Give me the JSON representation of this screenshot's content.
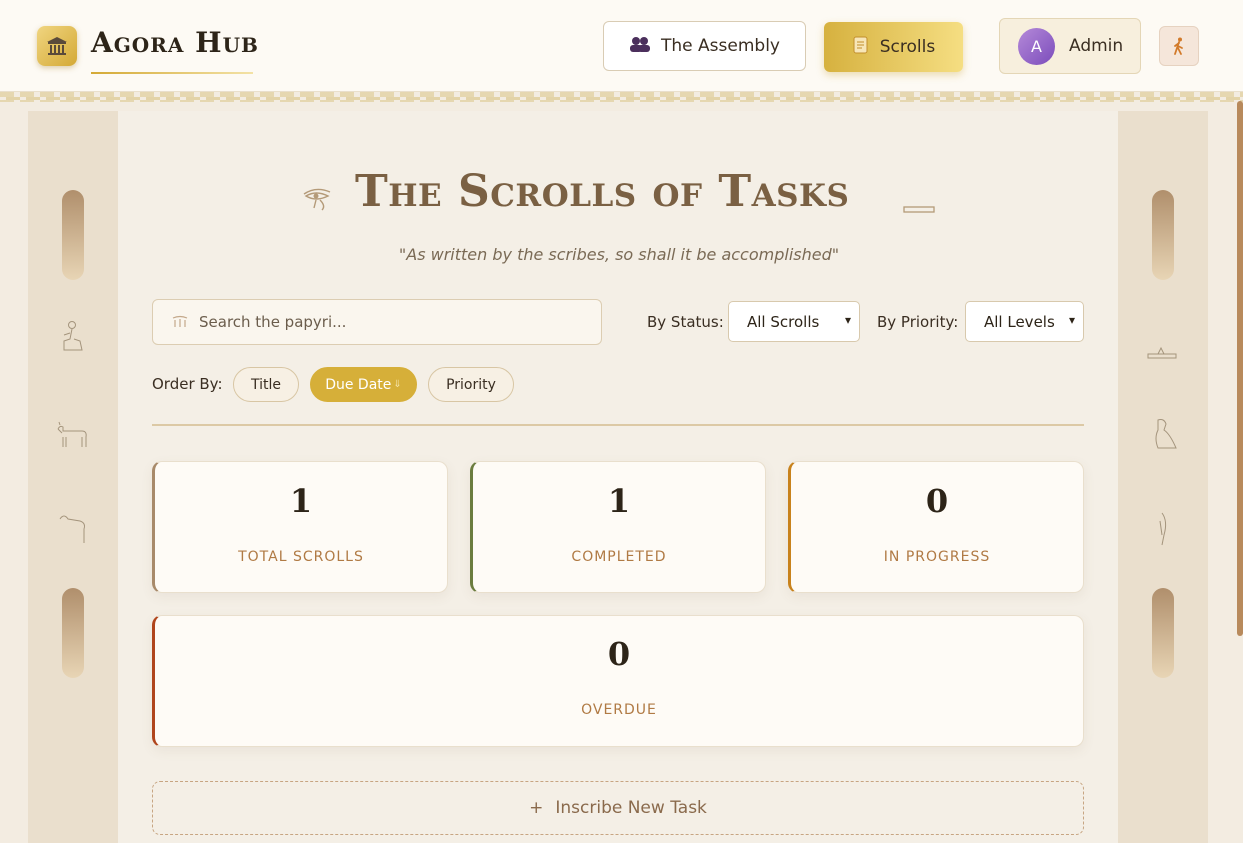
{
  "header": {
    "brand": "Agora Hub",
    "logo_icon": "temple-icon",
    "nav": {
      "assembly_label": "The Assembly",
      "scrolls_label": "Scrolls"
    },
    "user": {
      "avatar_initial": "A",
      "name": "Admin"
    },
    "logout_icon": "walking-figure-icon"
  },
  "page": {
    "title": "The Scrolls of Tasks",
    "subtitle": "\"As written by the scribes, so shall it be accomplished\""
  },
  "filters": {
    "search_placeholder": "Search the papyri...",
    "status_label": "By Status:",
    "status_value": "All Scrolls",
    "priority_label": "By Priority:",
    "priority_value": "All Levels",
    "order_label": "Order By:",
    "order_options": [
      "Title",
      "Due Date",
      "Priority"
    ],
    "order_active": "Due Date"
  },
  "stats": [
    {
      "value": "1",
      "label": "TOTAL SCROLLS",
      "accent": "#a88a6a"
    },
    {
      "value": "1",
      "label": "COMPLETED",
      "accent": "#6b7c3f"
    },
    {
      "value": "0",
      "label": "IN PROGRESS",
      "accent": "#c8821c"
    },
    {
      "value": "0",
      "label": "OVERDUE",
      "accent": "#b0451c"
    }
  ],
  "actions": {
    "new_task_label": "Inscribe New Task"
  },
  "colors": {
    "gold": "#d6af39",
    "parchment": "#f3ece1"
  }
}
